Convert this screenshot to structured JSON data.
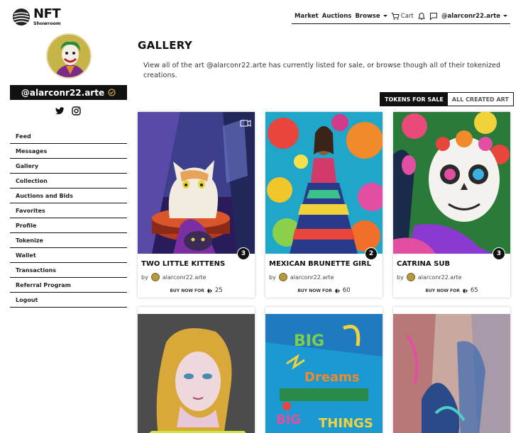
{
  "brand": {
    "name": "NFT",
    "subtitle": "Showroom"
  },
  "topnav": {
    "market": "Market",
    "auctions": "Auctions",
    "browse": "Browse",
    "cart": "Cart",
    "account": "@alarconr22.arte"
  },
  "profile": {
    "username": "@alarconr22.arte"
  },
  "sidebar": {
    "items": [
      {
        "label": "Feed"
      },
      {
        "label": "Messages"
      },
      {
        "label": "Gallery"
      },
      {
        "label": "Collection"
      },
      {
        "label": "Auctions and Bids"
      },
      {
        "label": "Favorites"
      },
      {
        "label": "Profile"
      },
      {
        "label": "Tokenize"
      },
      {
        "label": "Wallet"
      },
      {
        "label": "Transactions"
      },
      {
        "label": "Referral Program"
      },
      {
        "label": "Logout"
      }
    ]
  },
  "main": {
    "title": "GALLERY",
    "description": "View all of the art @alarconr22.arte has currently listed for sale, or browse though all of their tokenized creations.",
    "toggle": {
      "active": "TOKENS FOR SALE",
      "inactive": "ALL CREATED ART"
    }
  },
  "cards": [
    {
      "title": "TWO LITTLE KITTENS",
      "by": "by",
      "artist": "alarconr22.arte",
      "buy_label": "BUY NOW FOR",
      "price": "25",
      "count": "3"
    },
    {
      "title": "MEXICAN BRUNETTE GIRL",
      "by": "by",
      "artist": "alarconr22.arte",
      "buy_label": "BUY NOW FOR",
      "price": "60",
      "count": "2"
    },
    {
      "title": "CATRINA SUB",
      "by": "by",
      "artist": "alarconr22.arte",
      "buy_label": "BUY NOW FOR",
      "price": "65",
      "count": "3"
    }
  ],
  "colors": {
    "accent": "#111111",
    "background": "#ffffff",
    "verified": "#d8b04a"
  }
}
